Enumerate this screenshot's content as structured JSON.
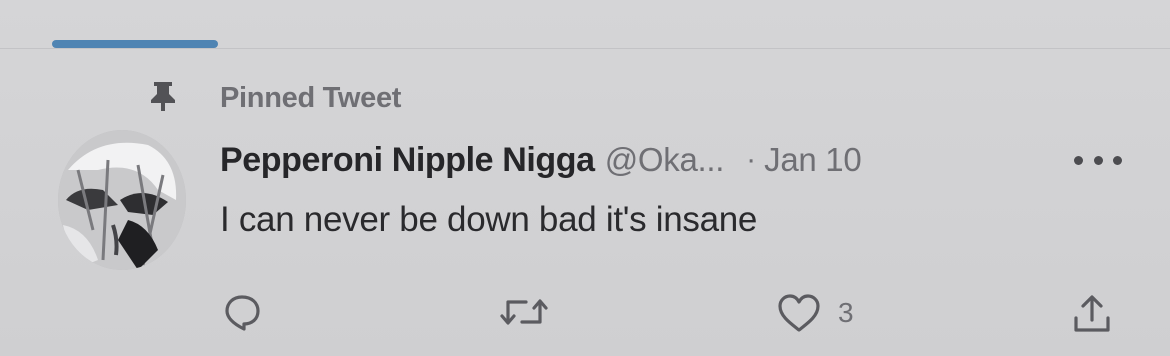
{
  "pinned": {
    "label": "Pinned Tweet",
    "icon": "pin-icon"
  },
  "tweet": {
    "display_name": "Pepperoni Nipple Nigga",
    "handle": "@Oka...",
    "separator": "·",
    "date": "Jan 10",
    "text": "I can never be down bad it's insane"
  },
  "actions": {
    "reply": {
      "icon": "reply-icon"
    },
    "retweet": {
      "icon": "retweet-icon"
    },
    "like": {
      "icon": "heart-icon",
      "count": "3"
    },
    "share": {
      "icon": "share-icon"
    }
  },
  "colors": {
    "accent": "#4f84b3",
    "background": "#d2d2d4",
    "secondary_text": "#6f6f74",
    "primary_text": "#262629"
  }
}
